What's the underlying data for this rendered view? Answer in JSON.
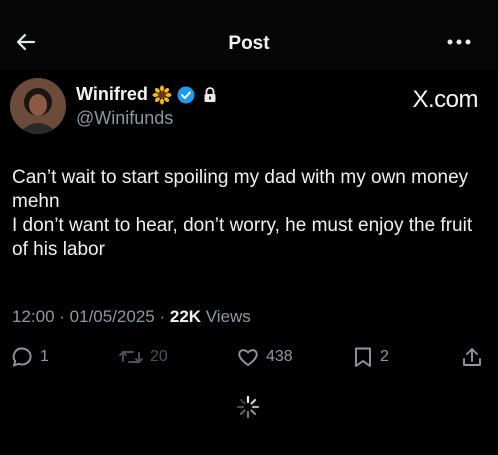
{
  "header": {
    "title": "Post"
  },
  "author": {
    "name": "Winifred",
    "handle": "@Winifunds",
    "name_emoji": "sunflower-icon"
  },
  "watermark": "X.com",
  "tweet": {
    "lines": [
      "Can’t wait to start spoiling my dad with my own money mehn",
      "I don’t want to hear, don’t worry, he must enjoy the fruit of his labor"
    ]
  },
  "meta": {
    "time": "12:00",
    "sep1": " · ",
    "date": "01/05/2025",
    "sep2": " · ",
    "views_count": "22K",
    "views_label": " Views"
  },
  "actions": {
    "replies": "1",
    "reposts": "20",
    "likes": "438",
    "bookmarks": "2"
  },
  "colors": {
    "background": "#000000",
    "text": "#e7e9ea",
    "muted": "#8b98a5",
    "verified": "#1d9bf0"
  }
}
